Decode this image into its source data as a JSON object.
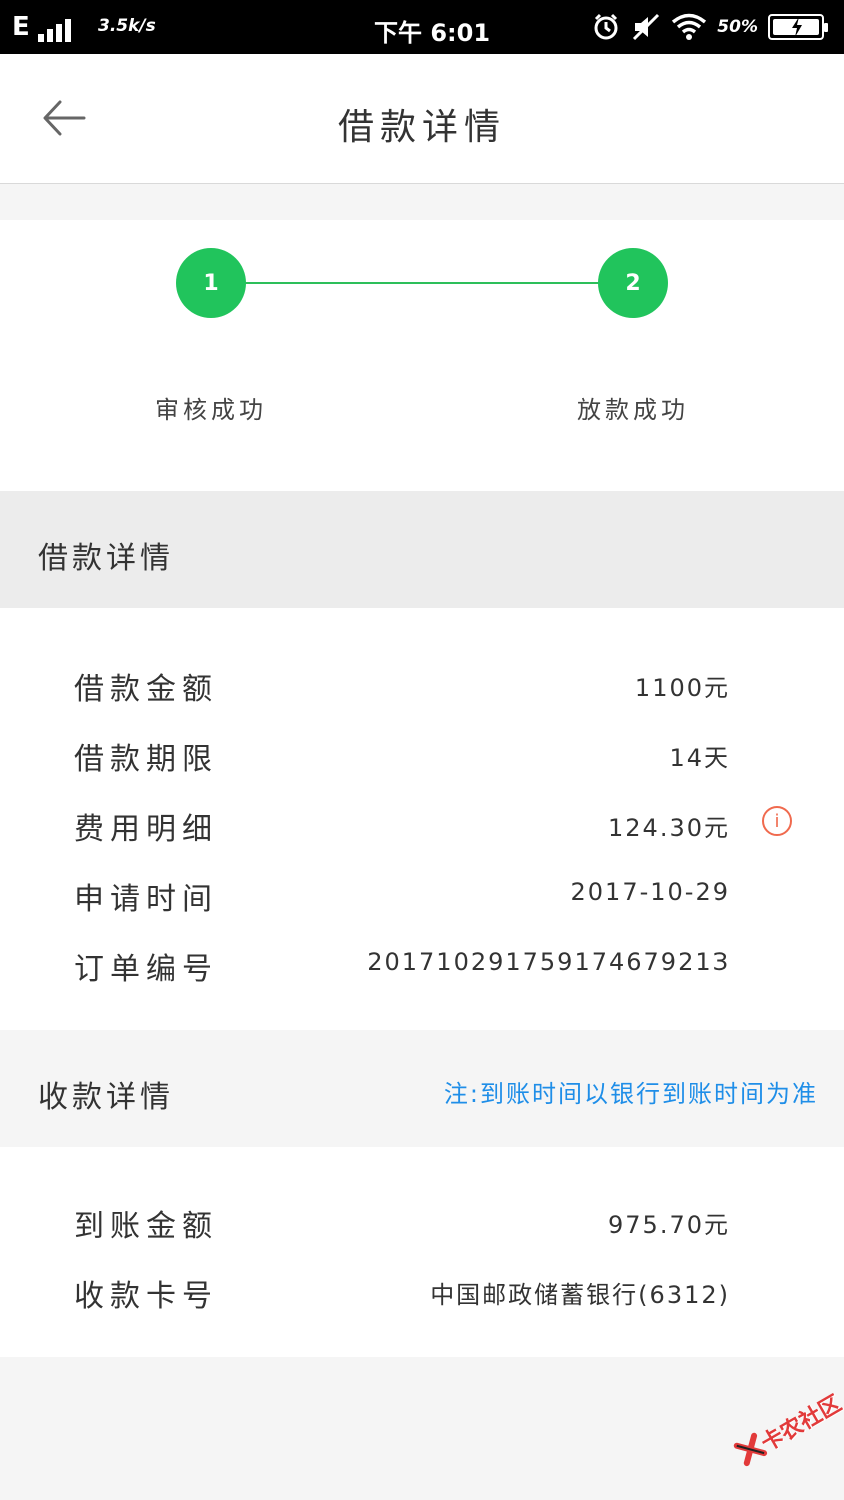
{
  "status_bar": {
    "network": "E",
    "speed": "3.5k/s",
    "time": "下午 6:01",
    "battery_percent": "50%",
    "icons": [
      "signal-bars-icon",
      "alarm-icon",
      "mute-icon",
      "wifi-icon",
      "battery-charging-icon"
    ]
  },
  "navbar": {
    "back_icon": "arrow-left-icon",
    "title": "借款详情"
  },
  "progress": {
    "accent_color": "#21c45c",
    "steps": [
      {
        "number": "1",
        "label": "审核成功"
      },
      {
        "number": "2",
        "label": "放款成功"
      }
    ]
  },
  "loan_details": {
    "title": "借款详情",
    "rows": [
      {
        "label": "借款金额",
        "value": "1100元"
      },
      {
        "label": "借款期限",
        "value": "14天"
      },
      {
        "label": "费用明细",
        "value": "124.30元"
      },
      {
        "label": "申请时间",
        "value": "2017-10-29"
      },
      {
        "label": "订单编号",
        "value": "20171029175917467921З"
      }
    ],
    "fee_info_icon": "info-circle-icon",
    "fee_info_glyph": "i"
  },
  "receipt_details": {
    "title": "收款详情",
    "note": "注:到账时间以银行到账时间为准",
    "note_color": "#1f8ee8",
    "rows": [
      {
        "label": "到账金额",
        "value": "975.70元"
      },
      {
        "label": "收款卡号",
        "value": "中国邮政储蓄银行(6312)"
      }
    ]
  },
  "watermark": {
    "text": "卡农社区"
  }
}
